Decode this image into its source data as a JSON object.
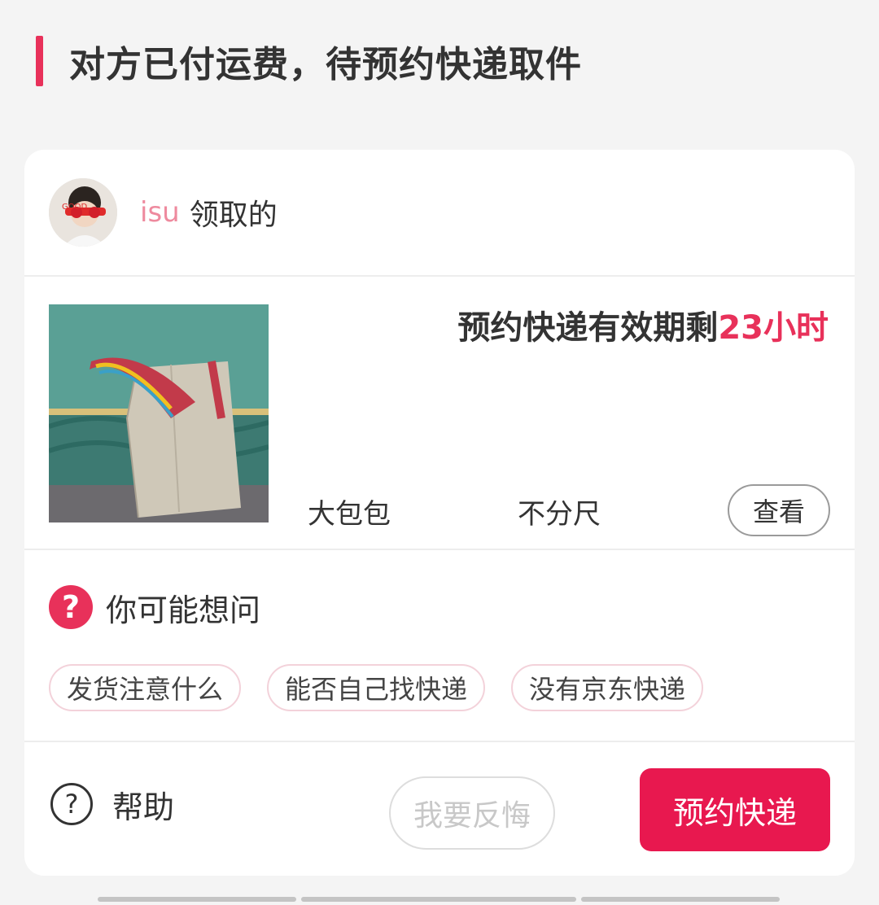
{
  "header": {
    "title": "对方已付运费，待预约快递取件"
  },
  "user": {
    "name": "isu",
    "suffix": "领取的",
    "avatar_text": "GOOD"
  },
  "item": {
    "validity_prefix": "预约快递有效期剩",
    "validity_remaining": "23小时",
    "name": "大包包",
    "size": "不分尺",
    "view_label": "查看"
  },
  "faq": {
    "title": "你可能想问",
    "chips": [
      "发货注意什么",
      "能否自己找快递",
      "没有京东快递"
    ]
  },
  "actions": {
    "help_label": "帮助",
    "regret_label": "我要反悔",
    "book_label": "预约快递"
  },
  "colors": {
    "accent": "#e8315a",
    "primary_button": "#e8184f",
    "username": "#ee8a9e"
  }
}
